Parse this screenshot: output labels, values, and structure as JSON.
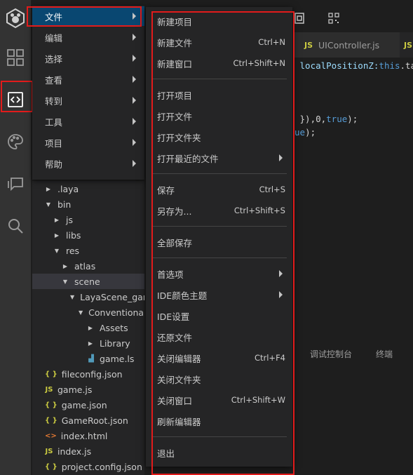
{
  "editor": {
    "tabs": [
      {
        "icon": "JS",
        "label": "UIController.js"
      },
      {
        "icon": "JS",
        "label": ""
      }
    ],
    "code_lines": [
      [
        {
          "t": " localPositionZ:",
          "c": "#9cdcfe"
        },
        {
          "t": "this",
          "c": "#569cd6"
        },
        {
          "t": ".ta",
          "c": "#d4d4d4"
        }
      ],
      [
        {
          "t": " }),0,",
          "c": "#d4d4d4"
        },
        {
          "t": "true",
          "c": "#569cd6"
        },
        {
          "t": ");",
          "c": "#d4d4d4"
        }
      ],
      [
        {
          "t": "ue",
          "c": "#569cd6"
        },
        {
          "t": ");",
          "c": "#d4d4d4"
        }
      ]
    ],
    "panel_tabs": [
      "调试控制台",
      "终端"
    ]
  },
  "explorer": {
    "items": [
      {
        "label": ".laya",
        "type": "folder",
        "open": false,
        "depth": 0
      },
      {
        "label": "bin",
        "type": "folder",
        "open": true,
        "depth": 0
      },
      {
        "label": "js",
        "type": "folder",
        "open": false,
        "depth": 1
      },
      {
        "label": "libs",
        "type": "folder",
        "open": false,
        "depth": 1
      },
      {
        "label": "res",
        "type": "folder",
        "open": true,
        "depth": 1
      },
      {
        "label": "atlas",
        "type": "folder",
        "open": false,
        "depth": 2
      },
      {
        "label": "scene",
        "type": "folder",
        "open": true,
        "depth": 2,
        "selected": true
      },
      {
        "label": "LayaScene_gam",
        "type": "folder",
        "open": true,
        "depth": 3
      },
      {
        "label": "Conventional",
        "type": "folder",
        "open": true,
        "depth": 4
      },
      {
        "label": "Assets",
        "type": "folder",
        "open": false,
        "depth": 5
      },
      {
        "label": "Library",
        "type": "folder",
        "open": false,
        "depth": 5
      },
      {
        "label": "game.ls",
        "type": "ls",
        "depth": 5
      },
      {
        "label": "fileconfig.json",
        "type": "json",
        "depth": 0
      },
      {
        "label": "game.js",
        "type": "js",
        "depth": 0
      },
      {
        "label": "game.json",
        "type": "json",
        "depth": 0
      },
      {
        "label": "GameRoot.json",
        "type": "json",
        "depth": 0
      },
      {
        "label": "index.html",
        "type": "html",
        "depth": 0
      },
      {
        "label": "index.js",
        "type": "js",
        "depth": 0
      },
      {
        "label": "project.config.json",
        "type": "json",
        "depth": 0
      }
    ]
  },
  "menubar": {
    "items": [
      {
        "label": "文件",
        "active": true
      },
      {
        "label": "编辑"
      },
      {
        "label": "选择"
      },
      {
        "label": "查看"
      },
      {
        "label": "转到"
      },
      {
        "label": "工具"
      },
      {
        "label": "项目"
      },
      {
        "label": "帮助"
      }
    ]
  },
  "file_menu": {
    "items": [
      {
        "label": "新建项目",
        "shortcut": ""
      },
      {
        "label": "新建文件",
        "shortcut": "Ctrl+N"
      },
      {
        "label": "新建窗口",
        "shortcut": "Ctrl+Shift+N"
      },
      {
        "sep": true
      },
      {
        "label": "打开项目",
        "shortcut": ""
      },
      {
        "label": "打开文件",
        "shortcut": ""
      },
      {
        "label": "打开文件夹",
        "shortcut": ""
      },
      {
        "label": "打开最近的文件",
        "shortcut": "",
        "submenu": true
      },
      {
        "sep": true
      },
      {
        "label": "保存",
        "shortcut": "Ctrl+S"
      },
      {
        "label": "另存为...",
        "shortcut": "Ctrl+Shift+S"
      },
      {
        "sep": true
      },
      {
        "label": "全部保存",
        "shortcut": ""
      },
      {
        "sep": true
      },
      {
        "label": "首选项",
        "shortcut": "",
        "submenu": true
      },
      {
        "label": "IDE颜色主题",
        "shortcut": "",
        "submenu": true
      },
      {
        "label": "IDE设置",
        "shortcut": ""
      },
      {
        "label": "还原文件",
        "shortcut": ""
      },
      {
        "label": "关闭编辑器",
        "shortcut": "Ctrl+F4"
      },
      {
        "label": "关闭文件夹",
        "shortcut": ""
      },
      {
        "label": "关闭窗口",
        "shortcut": "Ctrl+Shift+W"
      },
      {
        "label": "刷新编辑器",
        "shortcut": ""
      },
      {
        "sep": true
      },
      {
        "label": "退出",
        "shortcut": ""
      }
    ]
  },
  "colors": {
    "highlight_box": "#e21b1b",
    "menu_active": "#094771",
    "activity_bar": "#333333"
  }
}
